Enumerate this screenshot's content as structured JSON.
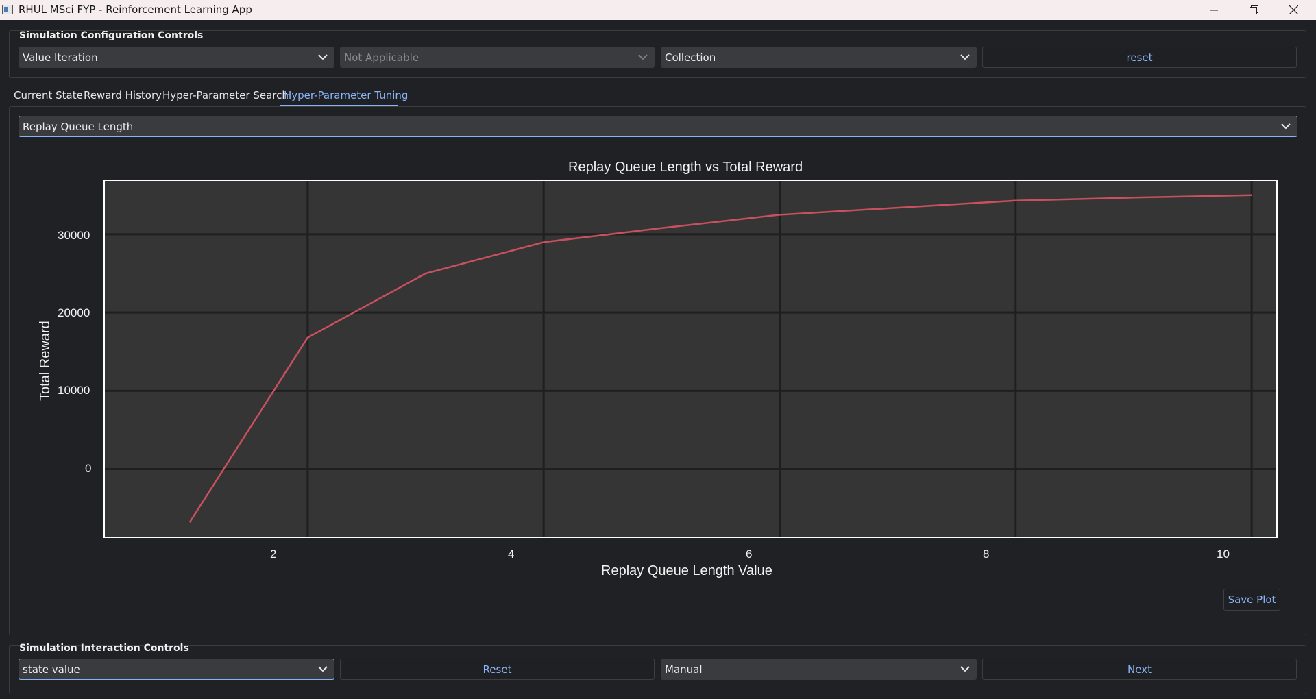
{
  "window": {
    "title": "RHUL MSci FYP - Reinforcement Learning App"
  },
  "config": {
    "group_title": "Simulation Configuration Controls",
    "algorithm": "Value Iteration",
    "secondary": "Not Applicable",
    "environment": "Collection",
    "reset_label": "reset"
  },
  "tabs": [
    {
      "label": "Current State"
    },
    {
      "label": "Reward History"
    },
    {
      "label": "Hyper-Parameter Search"
    },
    {
      "label": "Hyper-Parameter Tuning",
      "active": true
    }
  ],
  "tuning": {
    "parameter": "Replay Queue Length",
    "save_label": "Save Plot"
  },
  "chart_data": {
    "type": "line",
    "title": "Replay Queue Length vs Total Reward",
    "xlabel": "Replay Queue Length Value",
    "ylabel": "Total Reward",
    "x": [
      1,
      2,
      3,
      4,
      5,
      6,
      7,
      8,
      9,
      10
    ],
    "series": [
      {
        "values": [
          -6800,
          16800,
          25000,
          29000,
          30800,
          32500,
          33400,
          34300,
          34700,
          35000
        ],
        "color": "#c9505e"
      }
    ],
    "xticks": [
      "2",
      "4",
      "6",
      "8",
      "10"
    ],
    "yticks": [
      "0",
      "10000",
      "20000",
      "30000"
    ],
    "xlim": [
      0.27,
      10.22
    ],
    "ylim": [
      -8800,
      37000
    ],
    "grid": true,
    "background": "#353535"
  },
  "interaction": {
    "group_title": "Simulation Interaction Controls",
    "view_mode": "state value",
    "reset_label": "Reset",
    "step_mode": "Manual",
    "next_label": "Next"
  },
  "colors": {
    "accent": "#8ab4f8",
    "background": "#202124",
    "control": "#3a3b3e"
  }
}
